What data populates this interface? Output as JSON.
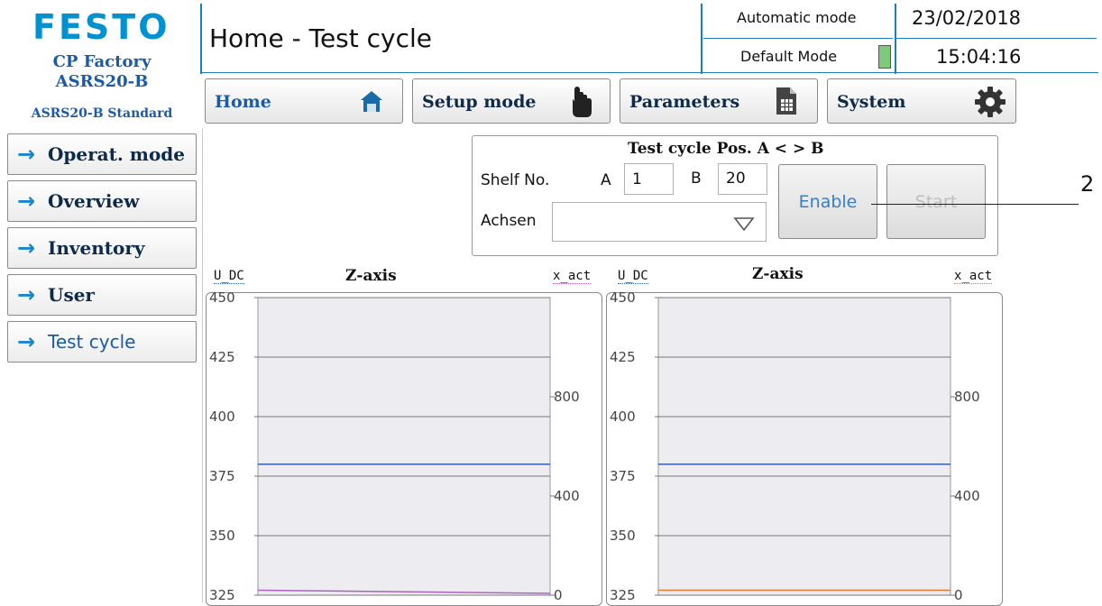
{
  "header": {
    "logo": "FESTO",
    "app_line1": "CP Factory",
    "app_line2": "ASRS20-B",
    "app_line3": "ASRS20-B Standard",
    "page_title": "Home - Test cycle",
    "mode": "Automatic mode",
    "sub_mode": "Default Mode",
    "date": "23/02/2018",
    "time": "15:04:16",
    "status_color": "#7ec97a"
  },
  "top_nav": [
    {
      "label": "Home",
      "icon": "house-icon"
    },
    {
      "label": "Setup mode",
      "icon": "hand-pointer-icon"
    },
    {
      "label": "Parameters",
      "icon": "document-table-icon"
    },
    {
      "label": "System",
      "icon": "gear-icon"
    }
  ],
  "side_nav": [
    {
      "label": "Operat. mode"
    },
    {
      "label": "Overview"
    },
    {
      "label": "Inventory"
    },
    {
      "label": "User"
    },
    {
      "label": "Test cycle"
    }
  ],
  "test_panel": {
    "title": "Test cycle Pos. A < > B",
    "shelf_label": "Shelf No.",
    "a_label": "A",
    "a_value": "1",
    "b_label": "B",
    "b_value": "20",
    "achsen_label": "Achsen",
    "achsen_value": "",
    "enable_label": "Enable",
    "start_label": "Start"
  },
  "annotation": "2",
  "chart_data": [
    {
      "type": "line",
      "title": "Z-axis",
      "ylabel": "U_DC",
      "y2label": "x_act",
      "ylim": [
        325,
        450
      ],
      "y_ticks": [
        "450",
        "425",
        "400",
        "375",
        "350",
        "325"
      ],
      "y2lim": [
        0,
        1200
      ],
      "y2_ticks": [
        "800",
        "400",
        "0"
      ],
      "series": [
        {
          "axis": "U_DC",
          "color": "#3a5fb0",
          "values": [
            380,
            380
          ]
        },
        {
          "axis": "x_act",
          "color": "#b060c0",
          "values": [
            20,
            0
          ]
        }
      ]
    },
    {
      "type": "line",
      "title": "Z-axis",
      "ylabel": "U_DC",
      "y2label": "x_act",
      "ylim": [
        325,
        450
      ],
      "y_ticks": [
        "450",
        "425",
        "400",
        "375",
        "350",
        "325"
      ],
      "y2lim": [
        0,
        1200
      ],
      "y2_ticks": [
        "800",
        "400",
        "0"
      ],
      "series": [
        {
          "axis": "U_DC",
          "color": "#3a5fb0",
          "values": [
            380,
            380
          ]
        },
        {
          "axis": "x_act",
          "color": "#e07a30",
          "values": [
            20,
            20
          ]
        }
      ]
    }
  ]
}
